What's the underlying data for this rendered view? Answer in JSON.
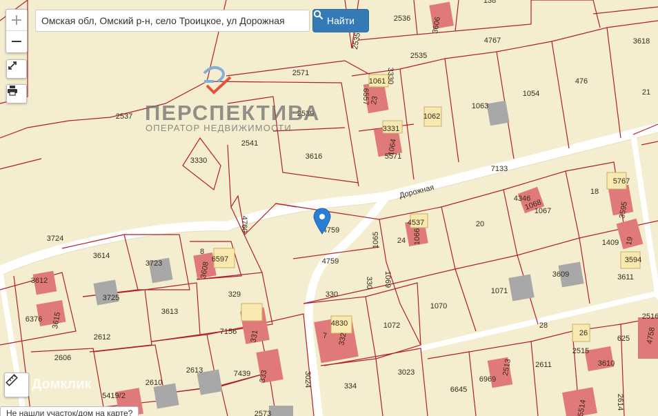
{
  "map": {
    "street_name": "Дорожная",
    "parcel_labels": [
      {
        "text": "2536"
      },
      {
        "text": "2535"
      },
      {
        "text": "2535"
      },
      {
        "text": "2571"
      },
      {
        "text": "4767"
      },
      {
        "text": "3618"
      },
      {
        "text": "2537"
      },
      {
        "text": "2539"
      },
      {
        "text": "2541"
      },
      {
        "text": "3616"
      },
      {
        "text": "3330"
      },
      {
        "text": "3330"
      },
      {
        "text": "6557"
      },
      {
        "text": "23"
      },
      {
        "text": "1061"
      },
      {
        "text": "1062"
      },
      {
        "text": "1063"
      },
      {
        "text": "1054"
      },
      {
        "text": "476"
      },
      {
        "text": "21"
      },
      {
        "text": "3331"
      },
      {
        "text": "5571"
      },
      {
        "text": "1064"
      },
      {
        "text": "7133"
      },
      {
        "text": "3606"
      },
      {
        "text": "3724"
      },
      {
        "text": "4760"
      },
      {
        "text": "4759"
      },
      {
        "text": "4759"
      },
      {
        "text": "1065"
      },
      {
        "text": "24"
      },
      {
        "text": "4537"
      },
      {
        "text": "1066"
      },
      {
        "text": "20"
      },
      {
        "text": "4346"
      },
      {
        "text": "1068"
      },
      {
        "text": "1067"
      },
      {
        "text": "18"
      },
      {
        "text": "5767"
      },
      {
        "text": "3595"
      },
      {
        "text": "1409"
      },
      {
        "text": "19"
      },
      {
        "text": "3594"
      },
      {
        "text": "3611"
      },
      {
        "text": "3614"
      },
      {
        "text": "3723"
      },
      {
        "text": "8"
      },
      {
        "text": "6597"
      },
      {
        "text": "3608"
      },
      {
        "text": "3612"
      },
      {
        "text": "3725"
      },
      {
        "text": "329"
      },
      {
        "text": "330"
      },
      {
        "text": "330"
      },
      {
        "text": "1069"
      },
      {
        "text": "1070"
      },
      {
        "text": "1071"
      },
      {
        "text": "3609"
      },
      {
        "text": "6376"
      },
      {
        "text": "3615"
      },
      {
        "text": "3613"
      },
      {
        "text": "2612"
      },
      {
        "text": "7156"
      },
      {
        "text": "331"
      },
      {
        "text": "7"
      },
      {
        "text": "4830"
      },
      {
        "text": "332"
      },
      {
        "text": "1072"
      },
      {
        "text": "28"
      },
      {
        "text": "26"
      },
      {
        "text": "2516"
      },
      {
        "text": "2515"
      },
      {
        "text": "625"
      },
      {
        "text": "4758"
      },
      {
        "text": "3610"
      },
      {
        "text": "2606"
      },
      {
        "text": "2613"
      },
      {
        "text": "7439"
      },
      {
        "text": "333"
      },
      {
        "text": "334"
      },
      {
        "text": "3023"
      },
      {
        "text": "6969"
      },
      {
        "text": "2513"
      },
      {
        "text": "2611"
      },
      {
        "text": "2610"
      },
      {
        "text": "5419/2"
      },
      {
        "text": "3024"
      },
      {
        "text": "6645"
      },
      {
        "text": "5514"
      },
      {
        "text": "2614"
      },
      {
        "text": "2573"
      },
      {
        "text": "138"
      }
    ]
  },
  "controls": {
    "zoom_in": "+",
    "zoom_out": "−",
    "fullscreen_icon": "expand-icon",
    "print_icon": "print-icon",
    "ruler_icon": "ruler-icon"
  },
  "search": {
    "value": "Омская обл, Омский р-н, село Троицкое, ул Дорожная",
    "button_label": "Найти"
  },
  "logo": {
    "title": "ПЕРСПЕКТИВА",
    "subtitle": "ОПЕРАТОР НЕДВИЖИМОСТИ"
  },
  "watermark": "Домклик",
  "bottom_link": "Не нашли участок/дом на карте?",
  "colors": {
    "map_background": "#f5edcf",
    "parcel_border": "#b01e2a",
    "building_red": "#e07a7a",
    "building_grey": "#a8a8a8",
    "road": "#ffffff",
    "marker": "#2a7fd4",
    "button": "#337ab7"
  }
}
